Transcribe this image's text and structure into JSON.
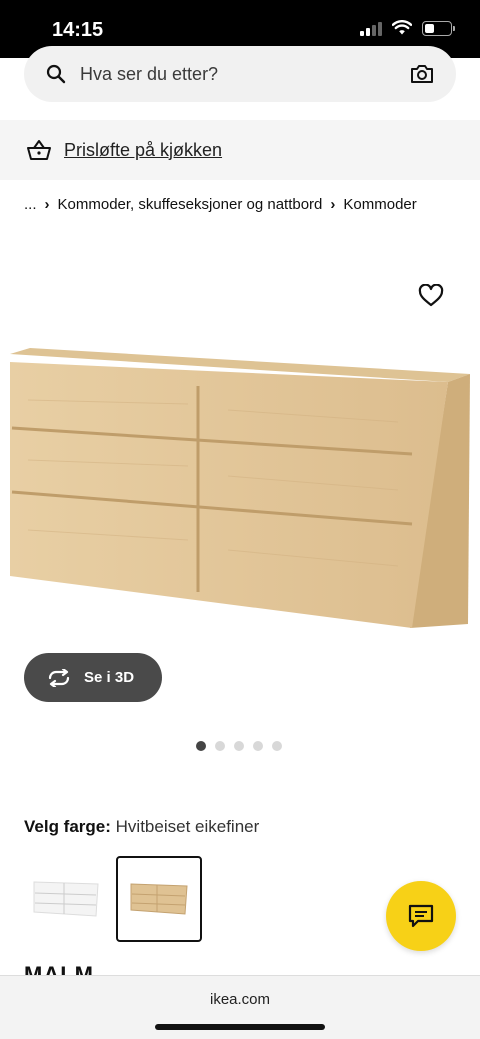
{
  "status": {
    "time": "14:15"
  },
  "search": {
    "placeholder": "Hva ser du etter?"
  },
  "promo": {
    "text": "Prisløfte på kjøkken"
  },
  "breadcrumb": {
    "ellipsis": "...",
    "items": [
      "Kommoder, skuffeseksjoner og nattbord",
      "Kommoder"
    ]
  },
  "gallery": {
    "view3d_label": "Se i 3D",
    "image_count": 5,
    "active_index": 0
  },
  "color": {
    "label": "Velg farge:",
    "value": "Hvitbeiset eikefiner",
    "swatches": [
      "white",
      "oak"
    ],
    "selected": 1
  },
  "product": {
    "name": "MALM"
  },
  "browser": {
    "url": "ikea.com"
  },
  "colors": {
    "accent": "#f7d117",
    "button_dark": "#4a4a4a",
    "wood": "#e3c79a"
  }
}
